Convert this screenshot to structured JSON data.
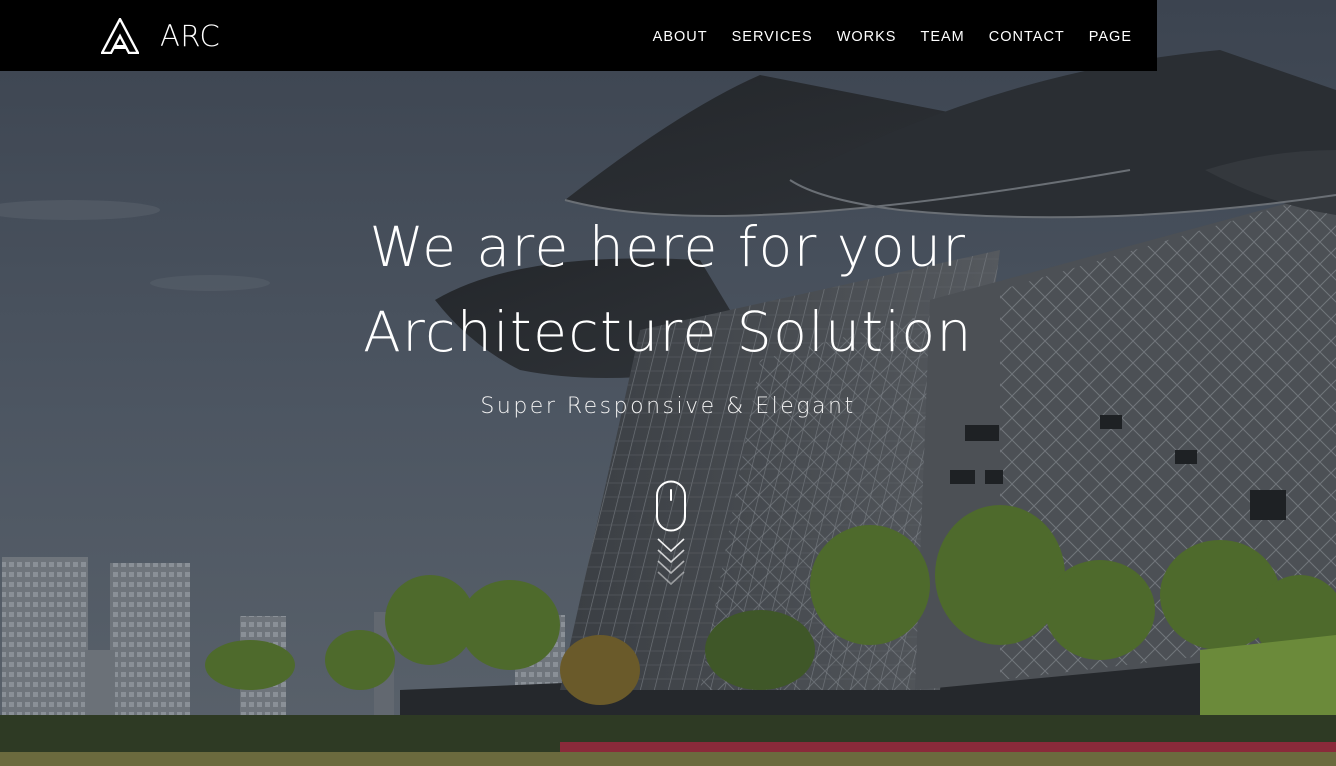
{
  "brand": {
    "name": "ARC",
    "logo_icon": "triangle-a-logo-icon"
  },
  "nav": {
    "items": [
      {
        "label": "ABOUT"
      },
      {
        "label": "SERVICES"
      },
      {
        "label": "WORKS"
      },
      {
        "label": "TEAM"
      },
      {
        "label": "CONTACT"
      },
      {
        "label": "PAGE"
      }
    ]
  },
  "hero": {
    "headline_line1": "We are here for your",
    "headline_line2": "Architecture Solution",
    "subtitle": "Super Responsive & Elegant",
    "scroll_icon": "mouse-scroll-icon",
    "chevron_icon": "double-chevron-down-icon"
  },
  "colors": {
    "navbar_bg": "#000000",
    "text": "#ffffff"
  }
}
